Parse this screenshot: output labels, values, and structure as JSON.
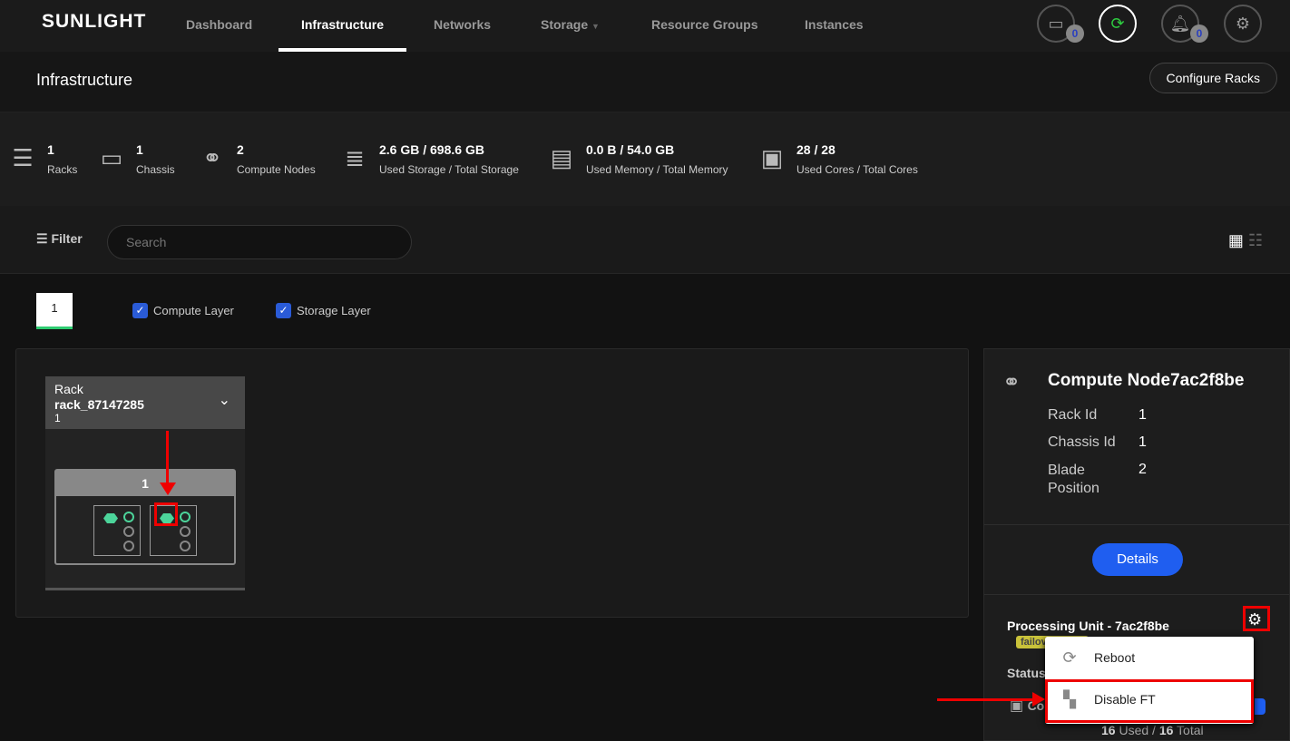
{
  "nav": {
    "logo": "SUNLIGHT",
    "items": [
      "Dashboard",
      "Infrastructure",
      "Networks",
      "Storage",
      "Resource Groups",
      "Instances"
    ],
    "active": "Infrastructure",
    "sim_count": "0",
    "notif_count": "0"
  },
  "page": {
    "title": "Infrastructure",
    "configure_label": "Configure Racks"
  },
  "stats": [
    {
      "value": "1",
      "label": "Racks",
      "icon": "rack-icon"
    },
    {
      "value": "1",
      "label": "Chassis",
      "icon": "chassis-icon"
    },
    {
      "value": "2",
      "label": "Compute Nodes",
      "icon": "node-icon"
    },
    {
      "value": "2.6 GB / 698.6 GB",
      "label": "Used Storage / Total Storage",
      "icon": "database-icon"
    },
    {
      "value": "0.0 B / 54.0 GB",
      "label": "Used Memory / Total Memory",
      "icon": "memory-icon"
    },
    {
      "value": "28 / 28",
      "label": "Used Cores / Total Cores",
      "icon": "cpu-icon"
    }
  ],
  "filter": {
    "label": "Filter",
    "placeholder": "Search"
  },
  "rack_tab": "1",
  "layers": {
    "compute": "Compute Layer",
    "storage": "Storage Layer"
  },
  "rack": {
    "label": "Rack",
    "name": "rack_87147285",
    "num": "1",
    "chassis": "1"
  },
  "node": {
    "title": "Compute Node7ac2f8be",
    "rack_id_label": "Rack Id",
    "rack_id": "1",
    "chassis_id_label": "Chassis Id",
    "chassis_id": "1",
    "blade_label": "Blade Position",
    "blade": "2",
    "details_label": "Details"
  },
  "pu": {
    "title": "Processing Unit - 7ac2f8be",
    "tag": "failov",
    "status_label": "Status",
    "cores_used": "16",
    "cores_total": "16",
    "used_word": "Used /",
    "total_word": "Total",
    "co": "Co"
  },
  "menu": {
    "reboot": "Reboot",
    "disable_ft": "Disable FT"
  },
  "colors": {
    "accent": "#1f5ef0",
    "node_active": "#4cd49a",
    "highlight": "#e00000"
  }
}
